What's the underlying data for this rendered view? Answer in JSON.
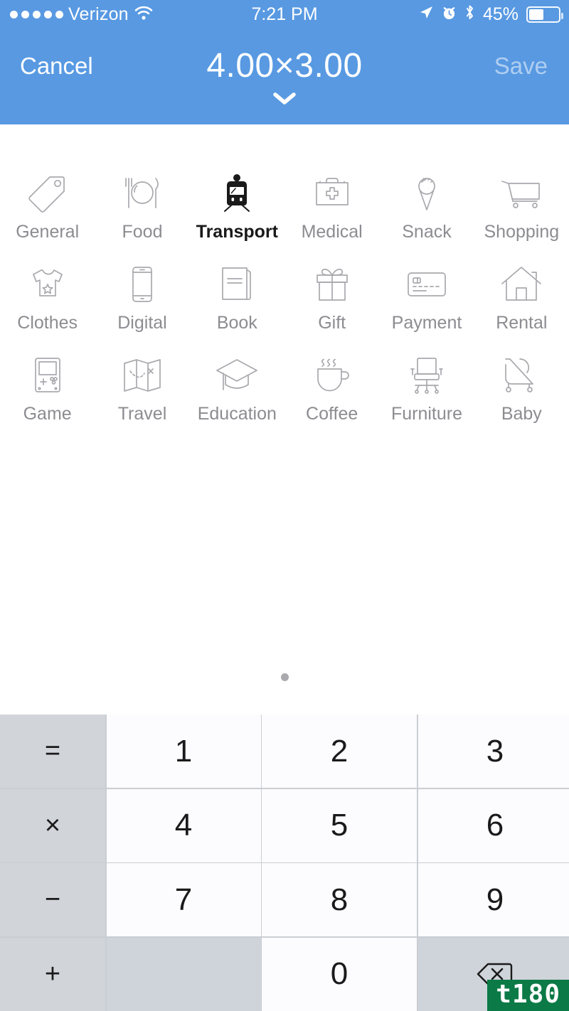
{
  "status_bar": {
    "signal_dots": 5,
    "carrier": "Verizon",
    "wifi_icon": "wifi-icon",
    "time": "7:21 PM",
    "location_icon": "location-arrow-icon",
    "alarm_icon": "alarm-clock-icon",
    "bluetooth_icon": "bluetooth-icon",
    "battery_percent": "45%",
    "battery_level": 45
  },
  "nav": {
    "cancel_label": "Cancel",
    "title": "4.00×3.00",
    "save_label": "Save",
    "save_enabled": false,
    "collapse_icon": "chevron-down-icon",
    "background_color": "#5899E2"
  },
  "categories": {
    "selected": "Transport",
    "items": [
      {
        "label": "General",
        "icon": "price-tag-icon",
        "selected": false
      },
      {
        "label": "Food",
        "icon": "plate-cutlery-icon",
        "selected": false
      },
      {
        "label": "Transport",
        "icon": "train-icon",
        "selected": true
      },
      {
        "label": "Medical",
        "icon": "first-aid-kit-icon",
        "selected": false
      },
      {
        "label": "Snack",
        "icon": "ice-cream-cone-icon",
        "selected": false
      },
      {
        "label": "Shopping",
        "icon": "shopping-cart-icon",
        "selected": false
      },
      {
        "label": "Clothes",
        "icon": "t-shirt-icon",
        "selected": false
      },
      {
        "label": "Digital",
        "icon": "smartphone-icon",
        "selected": false
      },
      {
        "label": "Book",
        "icon": "book-icon",
        "selected": false
      },
      {
        "label": "Gift",
        "icon": "gift-box-icon",
        "selected": false
      },
      {
        "label": "Payment",
        "icon": "credit-card-icon",
        "selected": false
      },
      {
        "label": "Rental",
        "icon": "house-icon",
        "selected": false
      },
      {
        "label": "Game",
        "icon": "handheld-console-icon",
        "selected": false
      },
      {
        "label": "Travel",
        "icon": "folded-map-icon",
        "selected": false
      },
      {
        "label": "Education",
        "icon": "graduation-cap-icon",
        "selected": false
      },
      {
        "label": "Coffee",
        "icon": "coffee-cup-icon",
        "selected": false
      },
      {
        "label": "Furniture",
        "icon": "office-chair-icon",
        "selected": false
      },
      {
        "label": "Baby",
        "icon": "stroller-icon",
        "selected": false
      }
    ],
    "page_count": 1,
    "active_page": 0
  },
  "keypad": {
    "keys": [
      {
        "label": "=",
        "type": "operator"
      },
      {
        "label": "1",
        "type": "number"
      },
      {
        "label": "2",
        "type": "number"
      },
      {
        "label": "3",
        "type": "number"
      },
      {
        "label": "×",
        "type": "operator"
      },
      {
        "label": "4",
        "type": "number"
      },
      {
        "label": "5",
        "type": "number"
      },
      {
        "label": "6",
        "type": "number"
      },
      {
        "label": "−",
        "type": "operator"
      },
      {
        "label": "7",
        "type": "number"
      },
      {
        "label": "8",
        "type": "number"
      },
      {
        "label": "9",
        "type": "number"
      },
      {
        "label": "+",
        "type": "operator"
      },
      {
        "label": "",
        "type": "blank"
      },
      {
        "label": "0",
        "type": "number"
      },
      {
        "label": "",
        "type": "backspace",
        "icon": "backspace-icon"
      }
    ],
    "key_background": "#FCFBFD",
    "operator_background": "#D1D5DA"
  },
  "watermark": {
    "text": "t180",
    "color": "#0B7A46"
  }
}
